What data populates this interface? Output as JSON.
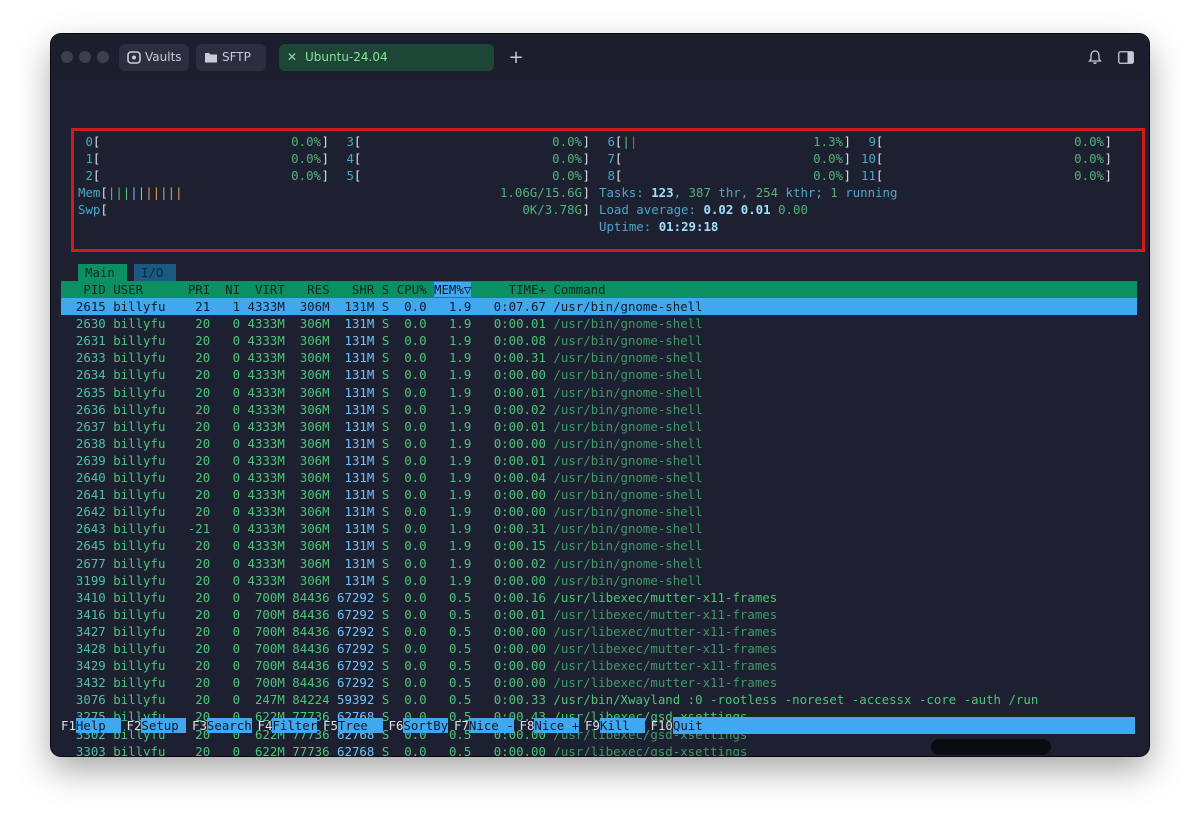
{
  "tabs": [
    {
      "label": "Vaults",
      "icon": "vault-icon"
    },
    {
      "label": "SFTP",
      "icon": "folder-icon"
    },
    {
      "label": "Ubuntu-24.04",
      "icon": "close-icon",
      "active": true
    }
  ],
  "new_tab_label": "+",
  "cpu_meters": [
    {
      "idx": "0",
      "pct": "0.0%"
    },
    {
      "idx": "1",
      "pct": "0.0%"
    },
    {
      "idx": "2",
      "pct": "0.0%"
    },
    {
      "idx": "3",
      "pct": "0.0%"
    },
    {
      "idx": "4",
      "pct": "0.0%"
    },
    {
      "idx": "5",
      "pct": "0.0%"
    },
    {
      "idx": "6",
      "pct": "1.3%"
    },
    {
      "idx": "7",
      "pct": "0.0%"
    },
    {
      "idx": "8",
      "pct": "0.0%"
    },
    {
      "idx": "9",
      "pct": "0.0%"
    },
    {
      "idx": "10",
      "pct": "0.0%"
    },
    {
      "idx": "11",
      "pct": "0.0%"
    }
  ],
  "mem": {
    "label": "Mem",
    "value": "1.06G/15.6G"
  },
  "swp": {
    "label": "Swp",
    "value": "0K/3.78G"
  },
  "tasks": {
    "label": "Tasks:",
    "count": "123",
    "thr": "387",
    "kthr": "254",
    "running": "1"
  },
  "load": {
    "label": "Load average:",
    "v1": "0.02",
    "v5": "0.01",
    "v15": "0.00"
  },
  "uptime": {
    "label": "Uptime:",
    "value": "01:29:18"
  },
  "screen_tabs": [
    "Main",
    "I/O"
  ],
  "columns": [
    "PID",
    "USER",
    "PRI",
    "NI",
    "VIRT",
    "RES",
    "SHR",
    "S",
    "CPU%",
    "MEM%▽",
    "TIME+",
    "Command"
  ],
  "processes": [
    [
      "2615",
      "billyfu",
      "21",
      "1",
      "4333M",
      "306M",
      "131M",
      "S",
      "0.0",
      "1.9",
      "0:07.67",
      "/usr/bin/gnome-shell"
    ],
    [
      "2630",
      "billyfu",
      "20",
      "0",
      "4333M",
      "306M",
      "131M",
      "S",
      "0.0",
      "1.9",
      "0:00.01",
      "/usr/bin/gnome-shell"
    ],
    [
      "2631",
      "billyfu",
      "20",
      "0",
      "4333M",
      "306M",
      "131M",
      "S",
      "0.0",
      "1.9",
      "0:00.08",
      "/usr/bin/gnome-shell"
    ],
    [
      "2633",
      "billyfu",
      "20",
      "0",
      "4333M",
      "306M",
      "131M",
      "S",
      "0.0",
      "1.9",
      "0:00.31",
      "/usr/bin/gnome-shell"
    ],
    [
      "2634",
      "billyfu",
      "20",
      "0",
      "4333M",
      "306M",
      "131M",
      "S",
      "0.0",
      "1.9",
      "0:00.00",
      "/usr/bin/gnome-shell"
    ],
    [
      "2635",
      "billyfu",
      "20",
      "0",
      "4333M",
      "306M",
      "131M",
      "S",
      "0.0",
      "1.9",
      "0:00.01",
      "/usr/bin/gnome-shell"
    ],
    [
      "2636",
      "billyfu",
      "20",
      "0",
      "4333M",
      "306M",
      "131M",
      "S",
      "0.0",
      "1.9",
      "0:00.02",
      "/usr/bin/gnome-shell"
    ],
    [
      "2637",
      "billyfu",
      "20",
      "0",
      "4333M",
      "306M",
      "131M",
      "S",
      "0.0",
      "1.9",
      "0:00.01",
      "/usr/bin/gnome-shell"
    ],
    [
      "2638",
      "billyfu",
      "20",
      "0",
      "4333M",
      "306M",
      "131M",
      "S",
      "0.0",
      "1.9",
      "0:00.00",
      "/usr/bin/gnome-shell"
    ],
    [
      "2639",
      "billyfu",
      "20",
      "0",
      "4333M",
      "306M",
      "131M",
      "S",
      "0.0",
      "1.9",
      "0:00.01",
      "/usr/bin/gnome-shell"
    ],
    [
      "2640",
      "billyfu",
      "20",
      "0",
      "4333M",
      "306M",
      "131M",
      "S",
      "0.0",
      "1.9",
      "0:00.04",
      "/usr/bin/gnome-shell"
    ],
    [
      "2641",
      "billyfu",
      "20",
      "0",
      "4333M",
      "306M",
      "131M",
      "S",
      "0.0",
      "1.9",
      "0:00.00",
      "/usr/bin/gnome-shell"
    ],
    [
      "2642",
      "billyfu",
      "20",
      "0",
      "4333M",
      "306M",
      "131M",
      "S",
      "0.0",
      "1.9",
      "0:00.00",
      "/usr/bin/gnome-shell"
    ],
    [
      "2643",
      "billyfu",
      "-21",
      "0",
      "4333M",
      "306M",
      "131M",
      "S",
      "0.0",
      "1.9",
      "0:00.31",
      "/usr/bin/gnome-shell"
    ],
    [
      "2645",
      "billyfu",
      "20",
      "0",
      "4333M",
      "306M",
      "131M",
      "S",
      "0.0",
      "1.9",
      "0:00.15",
      "/usr/bin/gnome-shell"
    ],
    [
      "2677",
      "billyfu",
      "20",
      "0",
      "4333M",
      "306M",
      "131M",
      "S",
      "0.0",
      "1.9",
      "0:00.02",
      "/usr/bin/gnome-shell"
    ],
    [
      "3199",
      "billyfu",
      "20",
      "0",
      "4333M",
      "306M",
      "131M",
      "S",
      "0.0",
      "1.9",
      "0:00.00",
      "/usr/bin/gnome-shell"
    ],
    [
      "3410",
      "billyfu",
      "20",
      "0",
      "700M",
      "84436",
      "67292",
      "S",
      "0.0",
      "0.5",
      "0:00.16",
      "/usr/libexec/mutter-x11-frames"
    ],
    [
      "3416",
      "billyfu",
      "20",
      "0",
      "700M",
      "84436",
      "67292",
      "S",
      "0.0",
      "0.5",
      "0:00.01",
      "/usr/libexec/mutter-x11-frames"
    ],
    [
      "3427",
      "billyfu",
      "20",
      "0",
      "700M",
      "84436",
      "67292",
      "S",
      "0.0",
      "0.5",
      "0:00.00",
      "/usr/libexec/mutter-x11-frames"
    ],
    [
      "3428",
      "billyfu",
      "20",
      "0",
      "700M",
      "84436",
      "67292",
      "S",
      "0.0",
      "0.5",
      "0:00.00",
      "/usr/libexec/mutter-x11-frames"
    ],
    [
      "3429",
      "billyfu",
      "20",
      "0",
      "700M",
      "84436",
      "67292",
      "S",
      "0.0",
      "0.5",
      "0:00.00",
      "/usr/libexec/mutter-x11-frames"
    ],
    [
      "3432",
      "billyfu",
      "20",
      "0",
      "700M",
      "84436",
      "67292",
      "S",
      "0.0",
      "0.5",
      "0:00.00",
      "/usr/libexec/mutter-x11-frames"
    ],
    [
      "3076",
      "billyfu",
      "20",
      "0",
      "247M",
      "84224",
      "59392",
      "S",
      "0.0",
      "0.5",
      "0:00.33",
      "/usr/bin/Xwayland :0 -rootless -noreset -accessx -core -auth /run"
    ],
    [
      "3275",
      "billyfu",
      "20",
      "0",
      "622M",
      "77736",
      "62768",
      "S",
      "0.0",
      "0.5",
      "0:00.43",
      "/usr/libexec/gsd-xsettings"
    ],
    [
      "3302",
      "billyfu",
      "20",
      "0",
      "622M",
      "77736",
      "62768",
      "S",
      "0.0",
      "0.5",
      "0:00.00",
      "/usr/libexec/gsd-xsettings"
    ],
    [
      "3303",
      "billyfu",
      "20",
      "0",
      "622M",
      "77736",
      "62768",
      "S",
      "0.0",
      "0.5",
      "0:00.00",
      "/usr/libexec/gsd-xsettings"
    ]
  ],
  "fkeys": [
    {
      "key": "F1",
      "label": "Help"
    },
    {
      "key": "F2",
      "label": "Setup"
    },
    {
      "key": "F3",
      "label": "Search"
    },
    {
      "key": "F4",
      "label": "Filter"
    },
    {
      "key": "F5",
      "label": "Tree"
    },
    {
      "key": "F6",
      "label": "SortBy"
    },
    {
      "key": "F7",
      "label": "Nice -"
    },
    {
      "key": "F8",
      "label": "Nice +"
    },
    {
      "key": "F9",
      "label": "Kill"
    },
    {
      "key": "F10",
      "label": "Quit"
    }
  ],
  "colors": {
    "accent_blue": "#41a8f0",
    "header_green": "#0c8f62",
    "highlight_red": "#d11a1a",
    "active_tab": "#1e4636"
  }
}
